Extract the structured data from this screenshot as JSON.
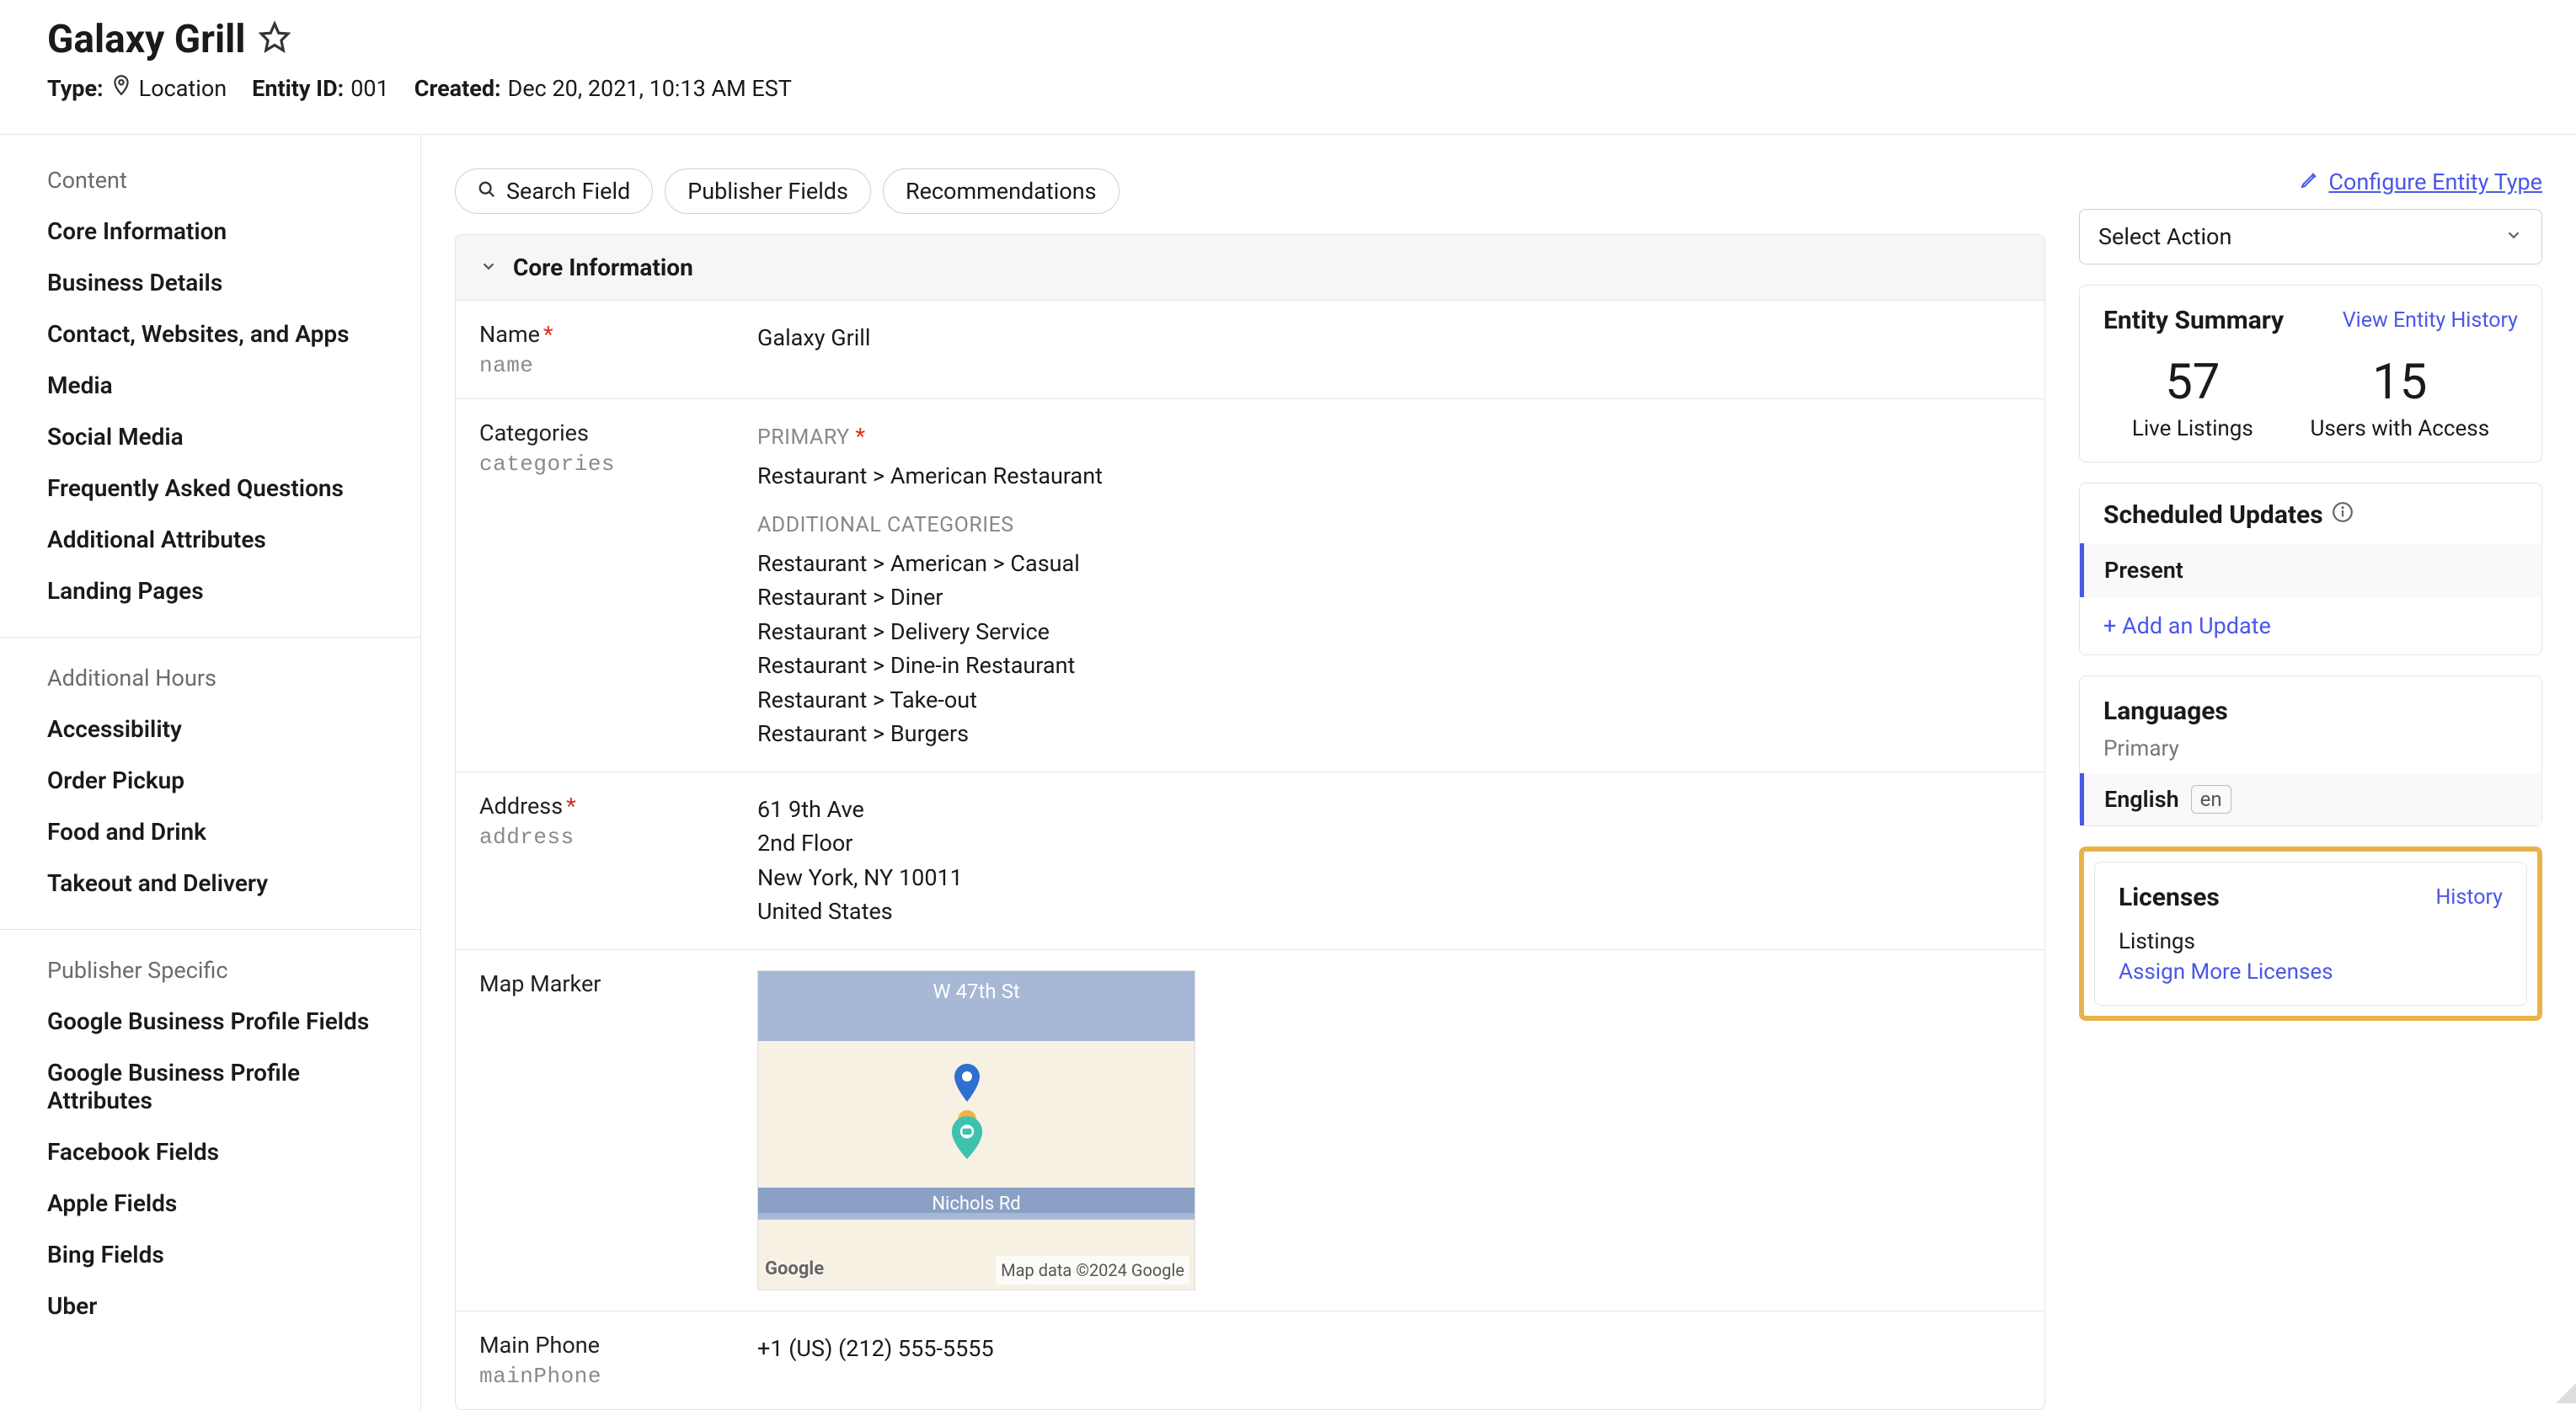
{
  "header": {
    "title": "Galaxy Grill",
    "type_label": "Type:",
    "type_value": "Location",
    "entity_id_label": "Entity ID:",
    "entity_id_value": "001",
    "created_label": "Created:",
    "created_value": "Dec 20, 2021, 10:13 AM EST"
  },
  "sidebar": {
    "content_label": "Content",
    "content_items": [
      "Core Information",
      "Business Details",
      "Contact, Websites, and Apps",
      "Media",
      "Social Media",
      "Frequently Asked Questions",
      "Additional Attributes",
      "Landing Pages"
    ],
    "hours_label": "Additional Hours",
    "hours_items": [
      "Accessibility",
      "Order Pickup",
      "Food and Drink",
      "Takeout and Delivery"
    ],
    "pub_label": "Publisher Specific",
    "pub_items": [
      "Google Business Profile Fields",
      "Google Business Profile Attributes",
      "Facebook Fields",
      "Apple Fields",
      "Bing Fields",
      "Uber"
    ]
  },
  "pills": {
    "search": "Search Field",
    "publisher": "Publisher Fields",
    "recs": "Recommendations"
  },
  "panel": {
    "title": "Core Information",
    "name_label": "Name",
    "name_api": "name",
    "name_value": "Galaxy Grill",
    "cat_label": "Categories",
    "cat_api": "categories",
    "primary_label": "PRIMARY",
    "primary_value": "Restaurant > American Restaurant",
    "addl_label": "ADDITIONAL CATEGORIES",
    "addl_values": [
      "Restaurant > American > Casual",
      "Restaurant > Diner",
      "Restaurant > Delivery Service",
      "Restaurant > Dine-in Restaurant",
      "Restaurant > Take-out",
      "Restaurant > Burgers"
    ],
    "address_label": "Address",
    "address_api": "address",
    "address_lines": [
      "61 9th Ave",
      "2nd Floor",
      "New York, NY 10011",
      "United States"
    ],
    "map_label": "Map Marker",
    "map_street": "W 47th St",
    "map_road": "Nichols Rd",
    "map_attr": "Map data ©2024 Google",
    "map_logo": "Google",
    "phone_label": "Main Phone",
    "phone_api": "mainPhone",
    "phone_value": "+1 (US) (212) 555-5555"
  },
  "rail": {
    "configure": "Configure Entity Type",
    "select_action": "Select Action",
    "summary_title": "Entity Summary",
    "summary_link": "View Entity History",
    "stat1_num": "57",
    "stat1_label": "Live Listings",
    "stat2_num": "15",
    "stat2_label": "Users with Access",
    "sched_title": "Scheduled Updates",
    "present": "Present",
    "add_update": "+ Add an Update",
    "lang_title": "Languages",
    "lang_primary": "Primary",
    "lang_name": "English",
    "lang_code": "en",
    "lic_title": "Licenses",
    "lic_history": "History",
    "lic_sub": "Listings",
    "lic_link": "Assign More Licenses"
  }
}
